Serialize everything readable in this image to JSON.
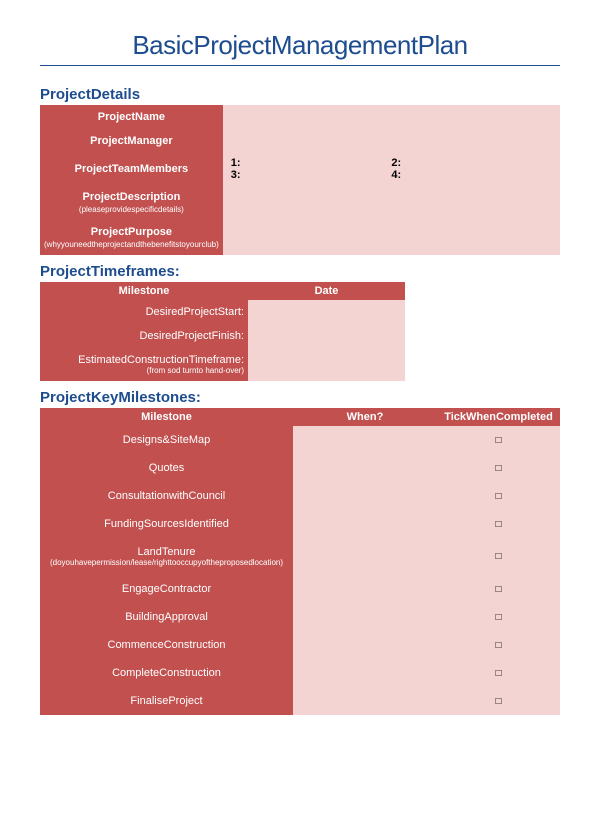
{
  "title": "BasicProjectManagementPlan",
  "sections": {
    "details_header": "ProjectDetails",
    "timeframes_header": "ProjectTimeframes:",
    "milestones_header": "ProjectKeyMilestones:"
  },
  "details": {
    "rows": [
      {
        "label": "ProjectName",
        "sub": "",
        "value": ""
      },
      {
        "label": "ProjectManager",
        "sub": "",
        "value": ""
      },
      {
        "label": "ProjectTeamMembers",
        "sub": "",
        "value": "members"
      },
      {
        "label": "ProjectDescription",
        "sub": "(pleaseprovidespecificdetails)",
        "value": ""
      },
      {
        "label": "ProjectPurpose",
        "sub": "(whyyouneedtheprojectandthebenefitstoyourclub)",
        "value": ""
      }
    ],
    "members": {
      "m1": "1:",
      "m2": "2:",
      "m3": "3:",
      "m4": "4:"
    }
  },
  "timeframes": {
    "headers": {
      "milestone": "Milestone",
      "date": "Date"
    },
    "rows": [
      {
        "label": "DesiredProjectStart:",
        "sub": "",
        "value": ""
      },
      {
        "label": "DesiredProjectFinish:",
        "sub": "",
        "value": ""
      },
      {
        "label": "EstimatedConstructionTimeframe:",
        "sub": "(from sod turnto hand-over)",
        "value": ""
      }
    ]
  },
  "milestones": {
    "headers": {
      "milestone": "Milestone",
      "when": "When?",
      "tick": "TickWhenCompleted"
    },
    "rows": [
      {
        "name": "Designs&SiteMap",
        "sub": "",
        "when": "",
        "tick": "□"
      },
      {
        "name": "Quotes",
        "sub": "",
        "when": "",
        "tick": "□"
      },
      {
        "name": "ConsultationwithCouncil",
        "sub": "",
        "when": "",
        "tick": "□"
      },
      {
        "name": "FundingSourcesIdentified",
        "sub": "",
        "when": "",
        "tick": "□"
      },
      {
        "name": "LandTenure",
        "sub": "(doyouhavepermission/lease/righttooccupyoftheproposedlocation)",
        "when": "",
        "tick": "□"
      },
      {
        "name": "EngageContractor",
        "sub": "",
        "when": "",
        "tick": "□"
      },
      {
        "name": "BuildingApproval",
        "sub": "",
        "when": "",
        "tick": "□"
      },
      {
        "name": "CommenceConstruction",
        "sub": "",
        "when": "",
        "tick": "□"
      },
      {
        "name": "CompleteConstruction",
        "sub": "",
        "when": "",
        "tick": "□"
      },
      {
        "name": "FinaliseProject",
        "sub": "",
        "when": "",
        "tick": "□"
      }
    ]
  }
}
